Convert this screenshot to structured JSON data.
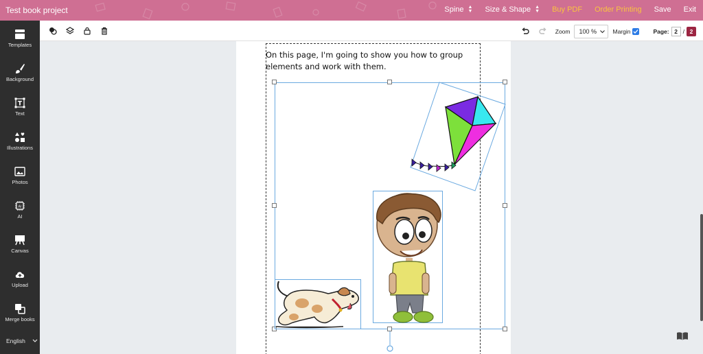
{
  "app": {
    "title": "Test book project"
  },
  "topnav": {
    "spine": "Spine",
    "size_shape": "Size & Shape",
    "buy_pdf": "Buy PDF",
    "order_printing": "Order Printing",
    "save": "Save",
    "exit": "Exit"
  },
  "sidebar": {
    "items": [
      {
        "label": "Templates",
        "icon": "templates-icon"
      },
      {
        "label": "Background",
        "icon": "brush-icon"
      },
      {
        "label": "Text",
        "icon": "text-icon"
      },
      {
        "label": "Illustrations",
        "icon": "shapes-icon"
      },
      {
        "label": "Photos",
        "icon": "image-icon"
      },
      {
        "label": "AI",
        "icon": "chip-icon"
      },
      {
        "label": "Canvas",
        "icon": "easel-icon"
      },
      {
        "label": "Upload",
        "icon": "cloud-upload-icon"
      },
      {
        "label": "Merge books",
        "icon": "merge-icon"
      }
    ],
    "language": "English"
  },
  "toolbar": {
    "zoom_label": "Zoom",
    "zoom_value": "100 %",
    "margin_label": "Margin",
    "margin_checked": true,
    "page_label": "Page:",
    "page_current": "2",
    "page_sep": "/",
    "page_total": "2"
  },
  "canvas": {
    "text": "On this page, I'm going to show you how to group elements and work with them.",
    "elements": [
      "kite",
      "boy",
      "dog"
    ]
  },
  "colors": {
    "topbar": "#cf6f93",
    "accent_orange": "#f9c33f",
    "sidebar": "#2e2e2e",
    "selection": "#6aa9e0",
    "page_total_bg": "#9c2542"
  }
}
